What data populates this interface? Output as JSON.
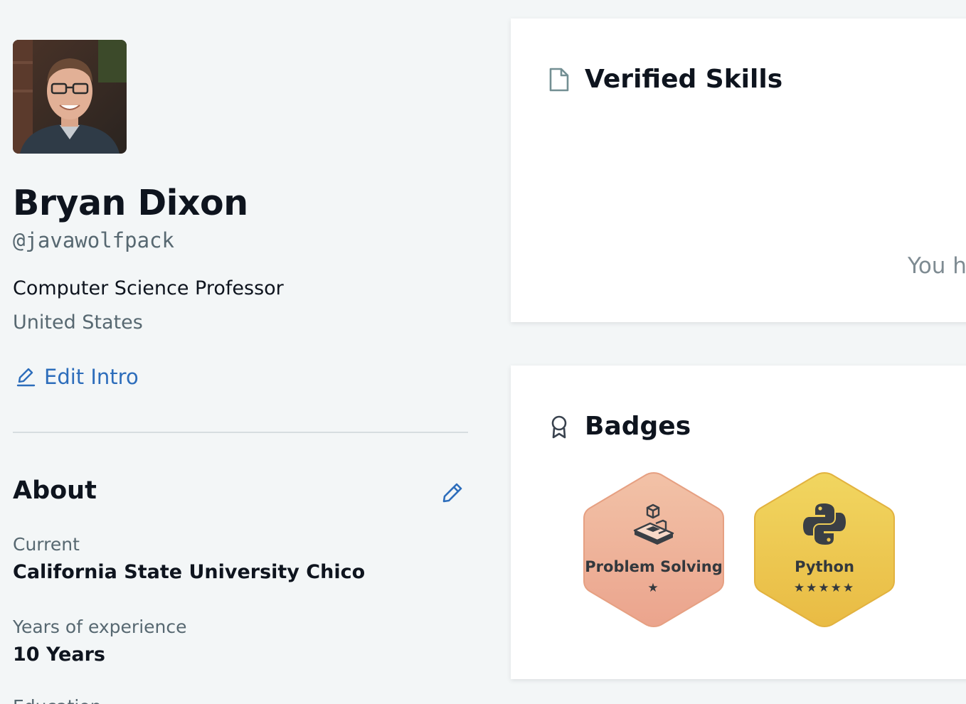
{
  "profile": {
    "name": "Bryan Dixon",
    "handle": "@javawolfpack",
    "job_title": "Computer Science Professor",
    "country": "United States",
    "edit_intro_label": "Edit Intro"
  },
  "about": {
    "title": "About",
    "current_label": "Current",
    "current_value": "California State University Chico",
    "experience_label": "Years of experience",
    "experience_value": "10 Years",
    "education_label": "Education"
  },
  "verified_skills": {
    "title": "Verified Skills",
    "icon": "document-icon",
    "empty_text": "You h"
  },
  "badges": {
    "title": "Badges",
    "icon": "award-ribbon-icon",
    "items": [
      {
        "name": "Problem Solving",
        "stars": "★",
        "icon": "blocks-icon",
        "color_top": "#f2c2a7",
        "color_bottom": "#eba48d",
        "stroke": "#e6a082"
      },
      {
        "name": "Python",
        "stars": "★★★★★",
        "icon": "python-icon",
        "color_top": "#f1d660",
        "color_bottom": "#e9bb44",
        "stroke": "#e2b23f"
      }
    ]
  },
  "colors": {
    "background": "#f3f6f7",
    "link": "#2d6dbb",
    "text_primary": "#0e141e",
    "text_secondary": "#576871"
  }
}
